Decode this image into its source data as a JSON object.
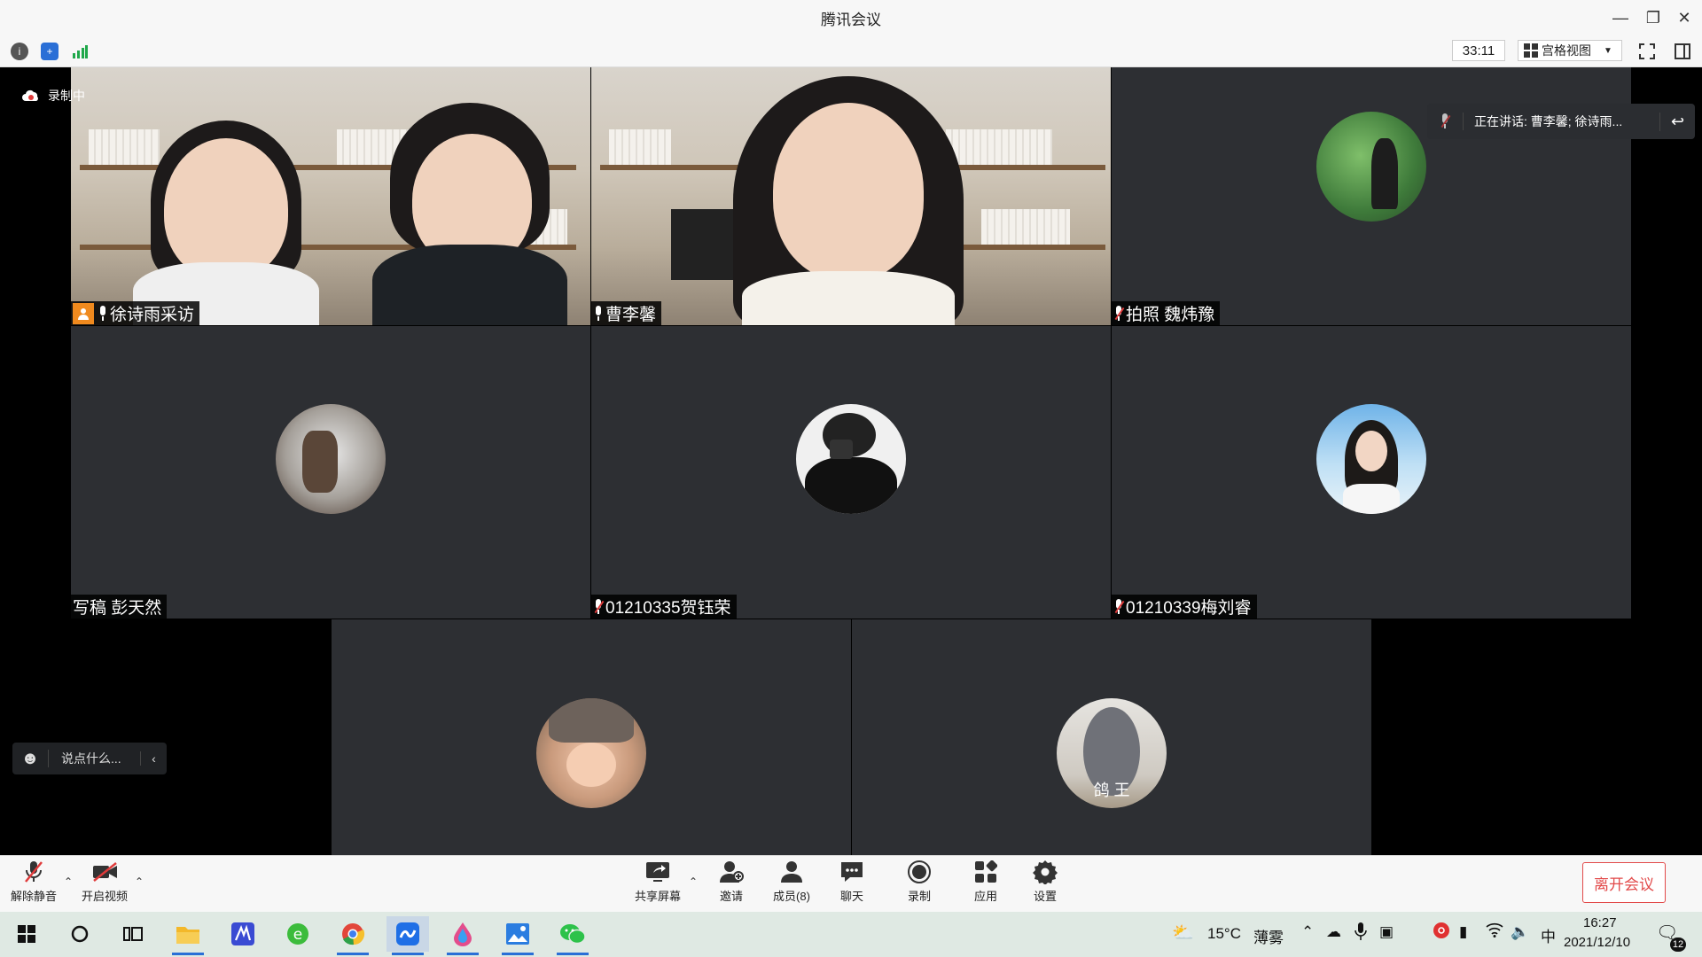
{
  "window": {
    "title": "腾讯会议",
    "timer": "33:11",
    "view_label": "宫格视图",
    "recording_label": "录制中",
    "speaking_label": "正在讲话: 曹李馨; 徐诗雨..."
  },
  "tiles": [
    {
      "name": "徐诗雨采访",
      "type": "video",
      "host": true,
      "muted": false
    },
    {
      "name": "曹李馨",
      "type": "video",
      "host": false,
      "muted": false,
      "active": true
    },
    {
      "name": "拍照  魏炜豫",
      "type": "avatar",
      "host": false,
      "muted": true
    },
    {
      "name": "写稿 彭天然",
      "type": "avatar",
      "host": false,
      "muted": false
    },
    {
      "name": "01210335贺钰荣",
      "type": "avatar",
      "host": false,
      "muted": true
    },
    {
      "name": "01210339梅刘睿",
      "type": "avatar",
      "host": false,
      "muted": true
    },
    {
      "name": "",
      "type": "avatar"
    },
    {
      "name": "",
      "type": "avatar",
      "avatar_text": "鸽 王"
    }
  ],
  "chat": {
    "placeholder": "说点什么..."
  },
  "toolbar": {
    "unmute": "解除静音",
    "start_video": "开启视频",
    "share_screen": "共享屏幕",
    "invite": "邀请",
    "members": "成员(8)",
    "chat": "聊天",
    "record": "录制",
    "apps": "应用",
    "settings": "设置",
    "leave": "离开会议"
  },
  "taskbar": {
    "weather_temp": "15°C",
    "weather_desc": "薄雾",
    "ime": "中",
    "time": "16:27",
    "date": "2021/12/10",
    "notification_count": "12"
  },
  "colors": {
    "accent_red": "#e24a4a",
    "tile_bg": "#2d2f33",
    "active_border": "#1f7a3a",
    "host_badge": "#f08a1e"
  }
}
